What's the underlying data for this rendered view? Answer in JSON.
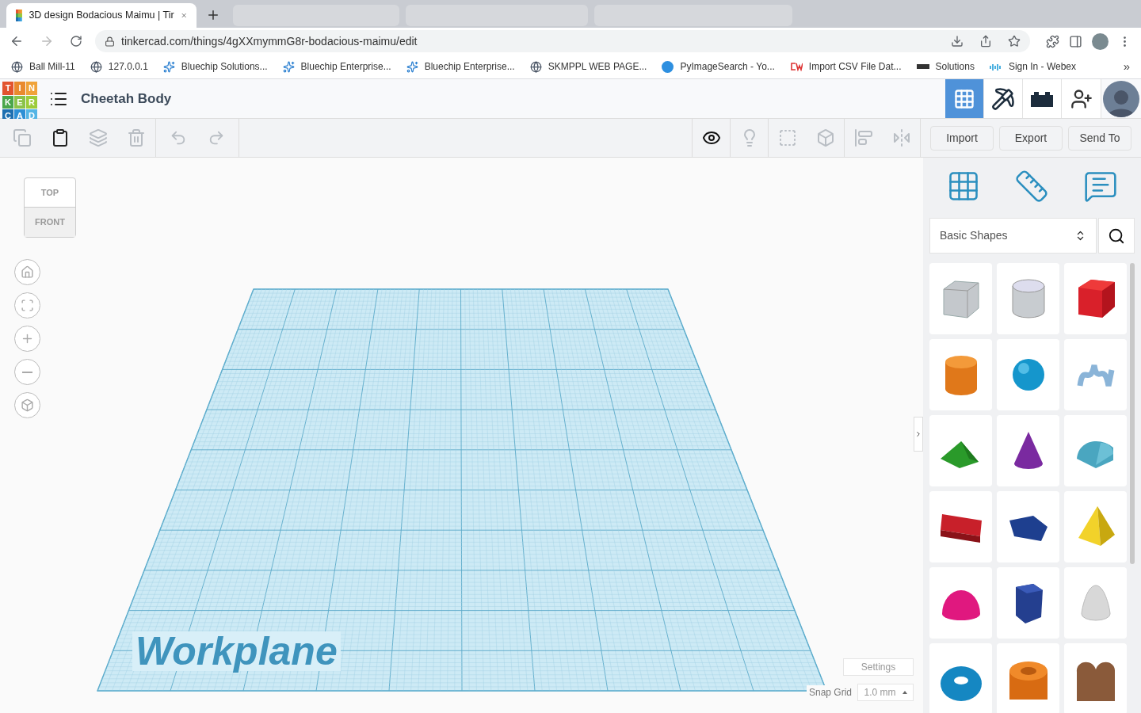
{
  "browser": {
    "tab_title": "3D design Bodacious Maimu | Tir",
    "url": "tinkercad.com/things/4gXXmymmG8r-bodacious-maimu/edit",
    "bookmarks": [
      {
        "kind": "globe",
        "label": "Ball Mill-11"
      },
      {
        "kind": "globe",
        "label": "127.0.0.1"
      },
      {
        "kind": "sparkle",
        "label": "Bluechip Solutions..."
      },
      {
        "kind": "sparkle",
        "label": "Bluechip Enterprise..."
      },
      {
        "kind": "sparkle",
        "label": "Bluechip Enterprise..."
      },
      {
        "kind": "globe",
        "label": "SKMPPL WEB PAGE..."
      },
      {
        "kind": "circle",
        "label": "PyImageSearch - Yo..."
      },
      {
        "kind": "cw",
        "label": "Import CSV File Dat..."
      },
      {
        "kind": "bar",
        "label": "Solutions"
      },
      {
        "kind": "dots",
        "label": "Sign In - Webex"
      }
    ],
    "bookmarks_overflow": "»"
  },
  "app": {
    "logo_letters": [
      "T",
      "I",
      "N",
      "K",
      "E",
      "R",
      "C",
      "A",
      "D"
    ],
    "design_title": "Cheetah Body",
    "mode_buttons": [
      {
        "kind": "grid",
        "selected": true
      },
      {
        "kind": "pickaxe",
        "selected": false
      },
      {
        "kind": "bricks",
        "selected": false
      }
    ],
    "actions": [
      "Import",
      "Export",
      "Send To"
    ]
  },
  "view_cube": {
    "top": "TOP",
    "front": "FRONT"
  },
  "workplane": {
    "label": "Workplane",
    "settings": "Settings",
    "snap_grid_label": "Snap Grid",
    "snap_grid_value": "1.0 mm"
  },
  "shapes_panel": {
    "category": "Basic Shapes"
  }
}
